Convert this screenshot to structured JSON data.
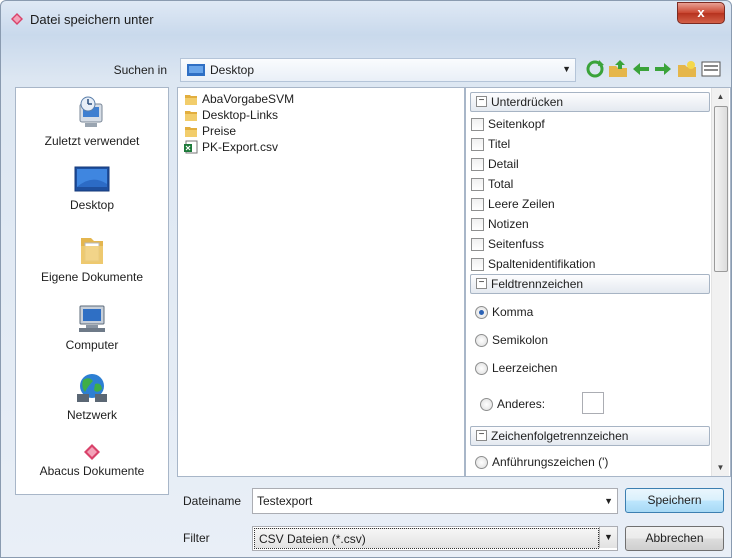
{
  "window": {
    "title": "Datei speichern unter",
    "close_label": "x"
  },
  "lookin": {
    "label": "Suchen in",
    "value": "Desktop"
  },
  "places": [
    {
      "label": "Zuletzt verwendet",
      "icon": "recent-places-icon"
    },
    {
      "label": "Desktop",
      "icon": "desktop-icon"
    },
    {
      "label": "Eigene Dokumente",
      "icon": "documents-folder-icon"
    },
    {
      "label": "Computer",
      "icon": "computer-icon"
    },
    {
      "label": "Netzwerk",
      "icon": "network-globe-icon"
    },
    {
      "label": "Abacus Dokumente",
      "icon": "abacus-diamond-icon"
    }
  ],
  "files": [
    {
      "name": "AbaVorgabeSVM",
      "type": "folder"
    },
    {
      "name": "Desktop-Links",
      "type": "folder"
    },
    {
      "name": "Preise",
      "type": "folder"
    },
    {
      "name": "PK-Export.csv",
      "type": "csv"
    }
  ],
  "options": {
    "suppress": {
      "header": "Unterdrücken",
      "items": [
        "Seitenkopf",
        "Titel",
        "Detail",
        "Total",
        "Leere Zeilen",
        "Notizen",
        "Seitenfuss",
        "Spaltenidentifikation"
      ]
    },
    "field_sep": {
      "header": "Feldtrennzeichen",
      "items": [
        "Komma",
        "Semikolon",
        "Leerzeichen",
        "Anderes:"
      ],
      "selected": "Komma"
    },
    "string_sep": {
      "header": "Zeichenfolgetrenn­zeichen",
      "items": [
        "Anführungszeichen (')"
      ]
    }
  },
  "filename": {
    "label": "Dateiname",
    "value": "Testexport"
  },
  "filter": {
    "label": "Filter",
    "value": "CSV Dateien (*.csv)"
  },
  "buttons": {
    "save": "Speichern",
    "cancel": "Abbrechen"
  },
  "colors": {
    "accent": "#3c7fb1",
    "radio_selected": "#2b62b5",
    "close": "#c9452f"
  }
}
